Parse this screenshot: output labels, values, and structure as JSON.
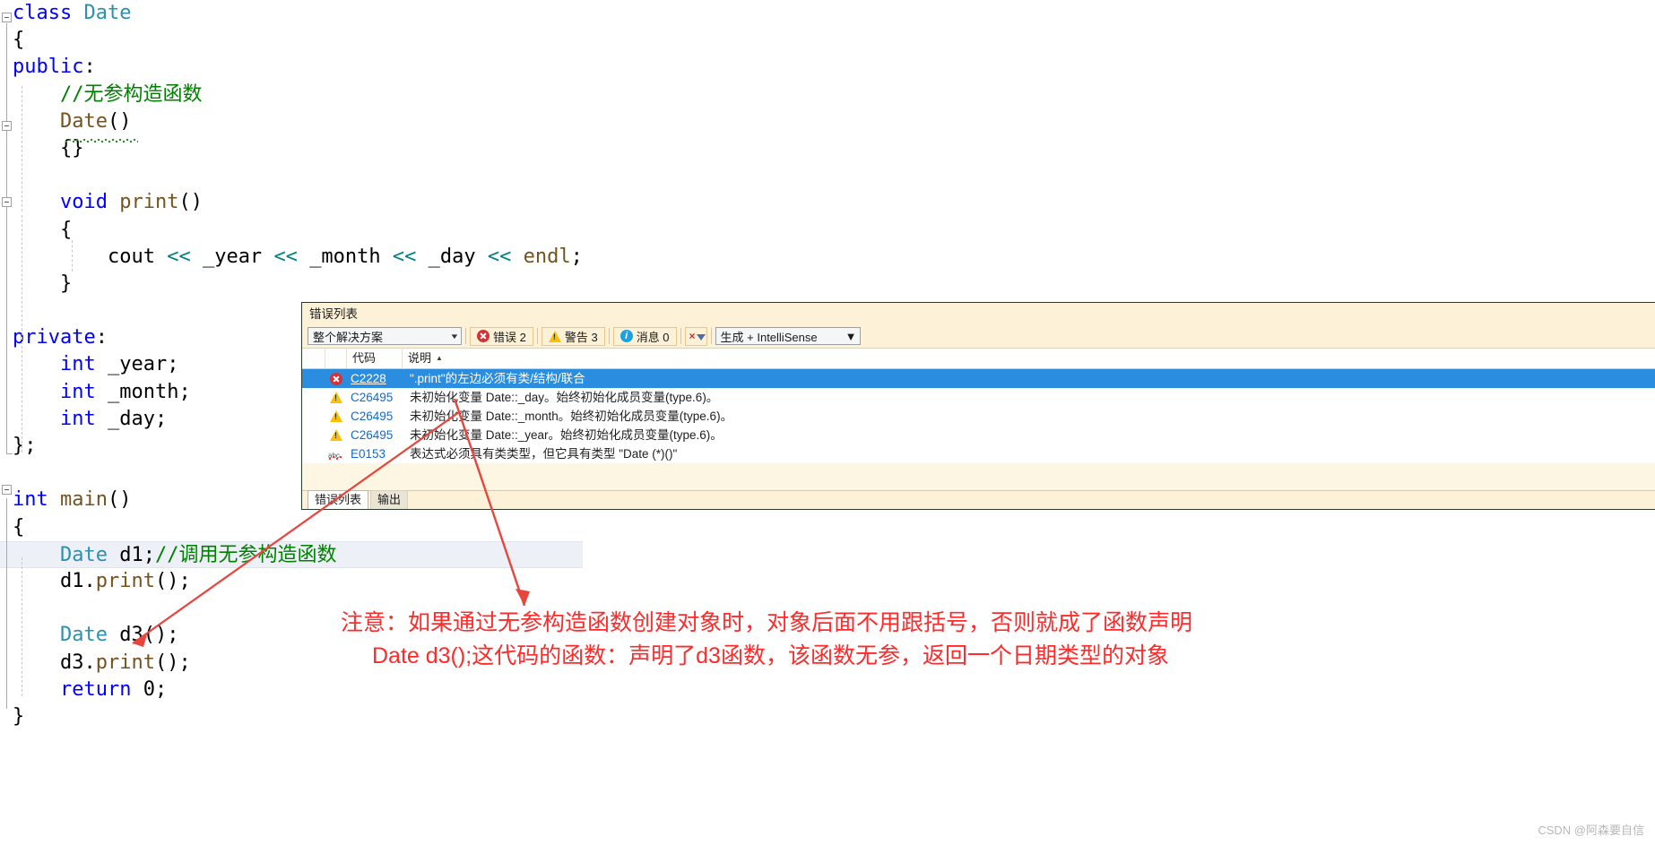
{
  "editor": {
    "language": "cpp",
    "lines": [
      {
        "indent": 0,
        "tokens": [
          {
            "t": "class ",
            "c": "kw"
          },
          {
            "t": "Date",
            "c": "type"
          }
        ]
      },
      {
        "indent": 0,
        "tokens": [
          {
            "t": "{",
            "c": "pl"
          }
        ]
      },
      {
        "indent": 0,
        "tokens": [
          {
            "t": "public",
            "c": "kw"
          },
          {
            "t": ":",
            "c": "pl"
          }
        ]
      },
      {
        "indent": 1,
        "tokens": [
          {
            "t": "//无参构造函数",
            "c": "cmt"
          }
        ]
      },
      {
        "indent": 1,
        "tokens": [
          {
            "t": "Date",
            "c": "fn"
          },
          {
            "t": "()",
            "c": "pl"
          }
        ]
      },
      {
        "indent": 1,
        "tokens": [
          {
            "t": "{}",
            "c": "pl"
          }
        ]
      },
      {
        "indent": 0,
        "tokens": []
      },
      {
        "indent": 1,
        "tokens": [
          {
            "t": "void ",
            "c": "kw"
          },
          {
            "t": "print",
            "c": "fn"
          },
          {
            "t": "()",
            "c": "pl"
          }
        ]
      },
      {
        "indent": 1,
        "tokens": [
          {
            "t": "{",
            "c": "pl"
          }
        ]
      },
      {
        "indent": 2,
        "tokens": [
          {
            "t": "cout ",
            "c": "pl"
          },
          {
            "t": "<< ",
            "c": "op"
          },
          {
            "t": "_year ",
            "c": "pl"
          },
          {
            "t": "<< ",
            "c": "op"
          },
          {
            "t": "_month ",
            "c": "pl"
          },
          {
            "t": "<< ",
            "c": "op"
          },
          {
            "t": "_day ",
            "c": "pl"
          },
          {
            "t": "<< ",
            "c": "op"
          },
          {
            "t": "endl",
            "c": "fn"
          },
          {
            "t": ";",
            "c": "pl"
          }
        ]
      },
      {
        "indent": 1,
        "tokens": [
          {
            "t": "}",
            "c": "pl"
          }
        ]
      },
      {
        "indent": 0,
        "tokens": []
      },
      {
        "indent": 0,
        "tokens": [
          {
            "t": "private",
            "c": "kw"
          },
          {
            "t": ":",
            "c": "pl"
          }
        ]
      },
      {
        "indent": 1,
        "tokens": [
          {
            "t": "int ",
            "c": "kw"
          },
          {
            "t": "_year;",
            "c": "pl"
          }
        ]
      },
      {
        "indent": 1,
        "tokens": [
          {
            "t": "int ",
            "c": "kw"
          },
          {
            "t": "_month;",
            "c": "pl"
          }
        ]
      },
      {
        "indent": 1,
        "tokens": [
          {
            "t": "int ",
            "c": "kw"
          },
          {
            "t": "_day;",
            "c": "pl"
          }
        ]
      },
      {
        "indent": 0,
        "tokens": [
          {
            "t": "};",
            "c": "pl"
          }
        ]
      },
      {
        "indent": 0,
        "tokens": []
      },
      {
        "indent": 0,
        "tokens": [
          {
            "t": "int ",
            "c": "kw"
          },
          {
            "t": "main",
            "c": "fn"
          },
          {
            "t": "()",
            "c": "pl"
          }
        ]
      },
      {
        "indent": 0,
        "tokens": [
          {
            "t": "{",
            "c": "pl"
          }
        ]
      },
      {
        "indent": 1,
        "highlight": true,
        "tokens": [
          {
            "t": "Date ",
            "c": "type"
          },
          {
            "t": "d1;",
            "c": "pl"
          },
          {
            "t": "//调用无参构造函数",
            "c": "cmt"
          }
        ]
      },
      {
        "indent": 1,
        "tokens": [
          {
            "t": "d1.",
            "c": "pl"
          },
          {
            "t": "print",
            "c": "fn"
          },
          {
            "t": "();",
            "c": "pl"
          }
        ]
      },
      {
        "indent": 0,
        "tokens": []
      },
      {
        "indent": 1,
        "tokens": [
          {
            "t": "Date ",
            "c": "type"
          },
          {
            "t": "d3();",
            "c": "pl"
          }
        ]
      },
      {
        "indent": 1,
        "tokens": [
          {
            "t": "d3.",
            "c": "pl"
          },
          {
            "t": "print",
            "c": "fn"
          },
          {
            "t": "();",
            "c": "pl"
          }
        ]
      },
      {
        "indent": 1,
        "tokens": [
          {
            "t": "return ",
            "c": "kw"
          },
          {
            "t": "0",
            "c": "pl"
          },
          {
            "t": ";",
            "c": "pl"
          }
        ]
      },
      {
        "indent": 0,
        "tokens": [
          {
            "t": "}",
            "c": "pl"
          }
        ]
      }
    ]
  },
  "error_list": {
    "title": "错误列表",
    "scope_filter": {
      "value": "整个解决方案",
      "caret": "▼"
    },
    "counters": [
      {
        "icon": "error-icon",
        "label": "错误 2"
      },
      {
        "icon": "warning-icon",
        "label": "警告 3"
      },
      {
        "icon": "info-icon",
        "label": "消息 0"
      }
    ],
    "clear_filter_label": "",
    "build_filter": {
      "value": "生成 + IntelliSense",
      "caret": "▼"
    },
    "columns": [
      "",
      "",
      "代码",
      "说明"
    ],
    "sort_indicator": "▲",
    "rows": [
      {
        "severity": "error",
        "code": "C2228",
        "description": "\".print\"的左边必须有类/结构/联合",
        "selected": true
      },
      {
        "severity": "warning",
        "code": "C26495",
        "description": "未初始化变量 Date::_day。始终初始化成员变量(type.6)。",
        "selected": false
      },
      {
        "severity": "warning",
        "code": "C26495",
        "description": "未初始化变量 Date::_month。始终初始化成员变量(type.6)。",
        "selected": false
      },
      {
        "severity": "warning",
        "code": "C26495",
        "description": "未初始化变量 Date::_year。始终初始化成员变量(type.6)。",
        "selected": false
      },
      {
        "severity": "intellisense",
        "code": "E0153",
        "description": "表达式必须具有类类型，但它具有类型 \"Date (*)()\"",
        "selected": false
      }
    ],
    "tabs": [
      {
        "label": "错误列表",
        "active": true
      },
      {
        "label": "输出",
        "active": false
      }
    ]
  },
  "annotation": {
    "line1": "注意：如果通过无参构造函数创建对象时，对象后面不用跟括号，否则就成了函数声明",
    "line2": "Date d3();这代码的函数：声明了d3函数，该函数无参，返回一个日期类型的对象",
    "color": "#ff2a2a"
  },
  "watermark": "CSDN @阿森要自信",
  "colors": {
    "keyword": "#0000ff",
    "type": "#2b91af",
    "function": "#74531f",
    "comment": "#008000",
    "operator": "#008080",
    "selection": "#2a8ddf",
    "panel_bg": "#fdf2d8",
    "annotation": "#ff2a2a"
  }
}
